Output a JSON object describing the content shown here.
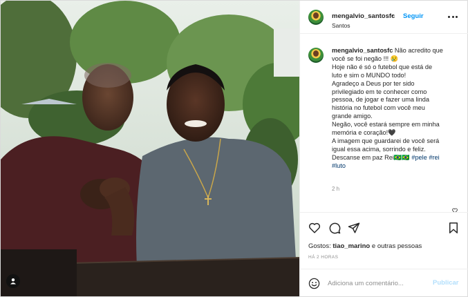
{
  "header": {
    "username": "mengalvio_santosfc",
    "separator": "•",
    "follow_label": "Seguir",
    "location": "Santos",
    "more_icon": "more-horizontal-icon"
  },
  "caption": {
    "username": "mengalvio_santosfc",
    "lines": [
      "Não acredito que",
      "você se foi negão !!! 😢",
      "Hoje não é só o futebol que está de",
      "luto e sim o MUNDO todo!",
      "Agradeço a Deus por ter sido",
      "privilegiado em te conhecer como",
      "pessoa, de jogar e fazer uma linda",
      "história no futebol com você meu",
      "grande amigo.",
      "Negão, você estará sempre em minha",
      "memória e coração!🖤",
      "A imagem que guardarei de você será",
      "igual essa acima, sorrindo e feliz.",
      "Descanse em paz Rei🇧🇷🇧🇷",
      "#luto"
    ],
    "hashtags": [
      "#pele",
      "#rei"
    ],
    "time": "2 h"
  },
  "actions": {
    "icons": [
      "heart-icon",
      "comment-icon",
      "share-icon",
      "bookmark-icon"
    ],
    "likes_prefix": "Gostos:",
    "likes_user": "tiao_marino",
    "likes_suffix": "e outras pessoas",
    "posted_ago": "HÁ 2 HORAS"
  },
  "comment": {
    "placeholder": "Adiciona um comentário...",
    "publish_label": "Publicar"
  },
  "colors": {
    "accent": "#0095f6",
    "publish_disabled": "#b2dffc",
    "hashtag": "#00376b",
    "muted": "#8e8e8e"
  }
}
